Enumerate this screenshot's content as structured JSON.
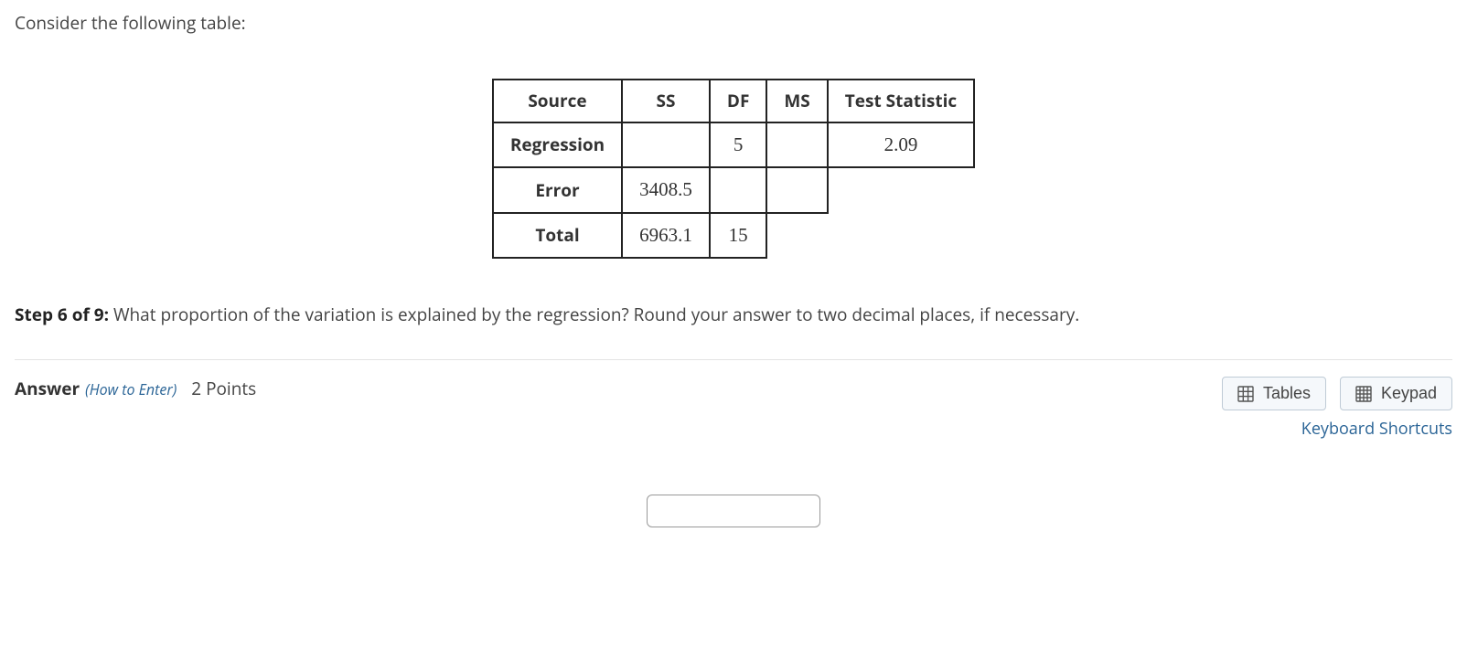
{
  "intro": "Consider the following table:",
  "table": {
    "headers": [
      "Source",
      "SS",
      "DF",
      "MS",
      "Test Statistic"
    ],
    "rows": [
      {
        "source": "Regression",
        "ss": "",
        "df": "5",
        "ms": "",
        "stat": "2.09",
        "show_ms": true,
        "show_stat": true
      },
      {
        "source": "Error",
        "ss": "3408.5",
        "df": "",
        "ms": "",
        "stat": "",
        "show_ms": true,
        "show_stat": false
      },
      {
        "source": "Total",
        "ss": "6963.1",
        "df": "15",
        "ms": "",
        "stat": "",
        "show_ms": false,
        "show_stat": false
      }
    ]
  },
  "step": {
    "label": "Step 6 of 9:",
    "text": "What proportion of the variation is explained by the regression? Round your answer to two decimal places, if necessary."
  },
  "answer_bar": {
    "label": "Answer",
    "how_to_enter": "(How to Enter)",
    "points": "2 Points",
    "tables_btn": "Tables",
    "keypad_btn": "Keypad",
    "kbd_shortcuts": "Keyboard Shortcuts"
  },
  "answer_value": ""
}
